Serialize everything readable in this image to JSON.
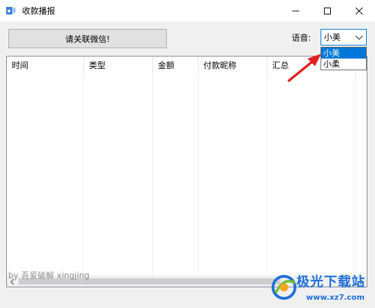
{
  "window": {
    "title": "收款播报",
    "minimize_icon": "minimize-icon",
    "maximize_icon": "maximize-icon",
    "close_icon": "close-icon"
  },
  "toolbar": {
    "follow_label": "请关联微信!",
    "voice_label": "语音:",
    "voice_selected": "小美"
  },
  "dropdown": {
    "options": [
      "小美",
      "小柔"
    ],
    "selected_index": 0
  },
  "table": {
    "columns": [
      "时间",
      "类型",
      "金额",
      "付款昵称",
      "汇总"
    ]
  },
  "footer": {
    "credit": "by 吾爱破解 xingjing"
  },
  "watermark": {
    "name": "极光下载站",
    "url": "www.xz7.com"
  },
  "colors": {
    "accent": "#0078d7",
    "arrow": "#e02020",
    "watermark": "#1e6fd9"
  }
}
